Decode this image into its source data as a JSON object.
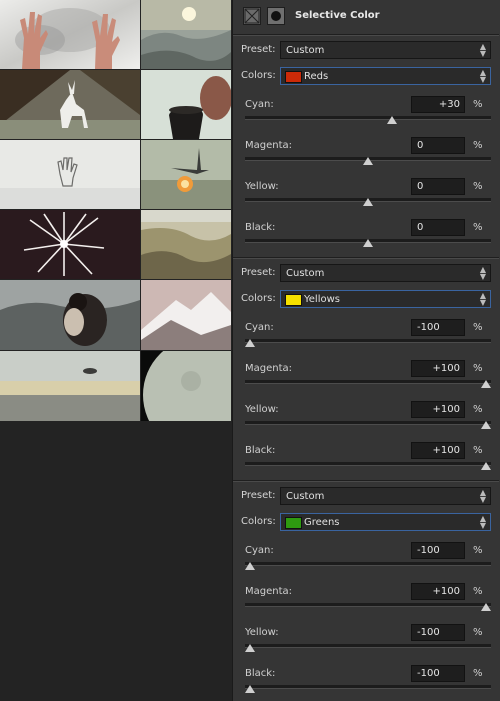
{
  "panel": {
    "title": "Selective Color",
    "adjustment_icon": "selective-color-adjustment-icon",
    "mask_icon": "layer-mask-icon"
  },
  "groups": [
    {
      "preset_label": "Preset:",
      "preset_value": "Custom",
      "colors_label": "Colors:",
      "colors_value": "Reds",
      "swatch_color": "#cc2a08",
      "sliders": [
        {
          "label": "Cyan:",
          "value": "+30",
          "unit": "%",
          "level": 60
        },
        {
          "label": "Magenta:",
          "value": "0",
          "unit": "%",
          "level": 50
        },
        {
          "label": "Yellow:",
          "value": "0",
          "unit": "%",
          "level": 50
        },
        {
          "label": "Black:",
          "value": "0",
          "unit": "%",
          "level": 50
        }
      ]
    },
    {
      "preset_label": "Preset:",
      "preset_value": "Custom",
      "colors_label": "Colors:",
      "colors_value": "Yellows",
      "swatch_color": "#f4e000",
      "sliders": [
        {
          "label": "Cyan:",
          "value": "-100",
          "unit": "%",
          "level": 0
        },
        {
          "label": "Magenta:",
          "value": "+100",
          "unit": "%",
          "level": 100
        },
        {
          "label": "Yellow:",
          "value": "+100",
          "unit": "%",
          "level": 100
        },
        {
          "label": "Black:",
          "value": "+100",
          "unit": "%",
          "level": 100
        }
      ]
    },
    {
      "preset_label": "Preset:",
      "preset_value": "Custom",
      "colors_label": "Colors:",
      "colors_value": "Greens",
      "swatch_color": "#2e9a10",
      "sliders": [
        {
          "label": "Cyan:",
          "value": "-100",
          "unit": "%",
          "level": 0
        },
        {
          "label": "Magenta:",
          "value": "+100",
          "unit": "%",
          "level": 100
        },
        {
          "label": "Yellow:",
          "value": "-100",
          "unit": "%",
          "level": 0
        },
        {
          "label": "Black:",
          "value": "-100",
          "unit": "%",
          "level": 0
        }
      ]
    }
  ],
  "images": [
    {
      "name": "hands-smoke-photo"
    },
    {
      "name": "sun-landscape-photo"
    },
    {
      "name": "white-creature-ruins-photo"
    },
    {
      "name": "cup-portrait-photo"
    },
    {
      "name": "handprint-snow-photo"
    },
    {
      "name": "spaceship-explosion-photo"
    },
    {
      "name": "ice-starburst-photo"
    },
    {
      "name": "canyon-landscape-photo"
    },
    {
      "name": "embracing-couple-photo"
    },
    {
      "name": "snow-mountain-photo"
    },
    {
      "name": "ship-over-sea-photo"
    },
    {
      "name": "moon-planet-photo"
    }
  ]
}
